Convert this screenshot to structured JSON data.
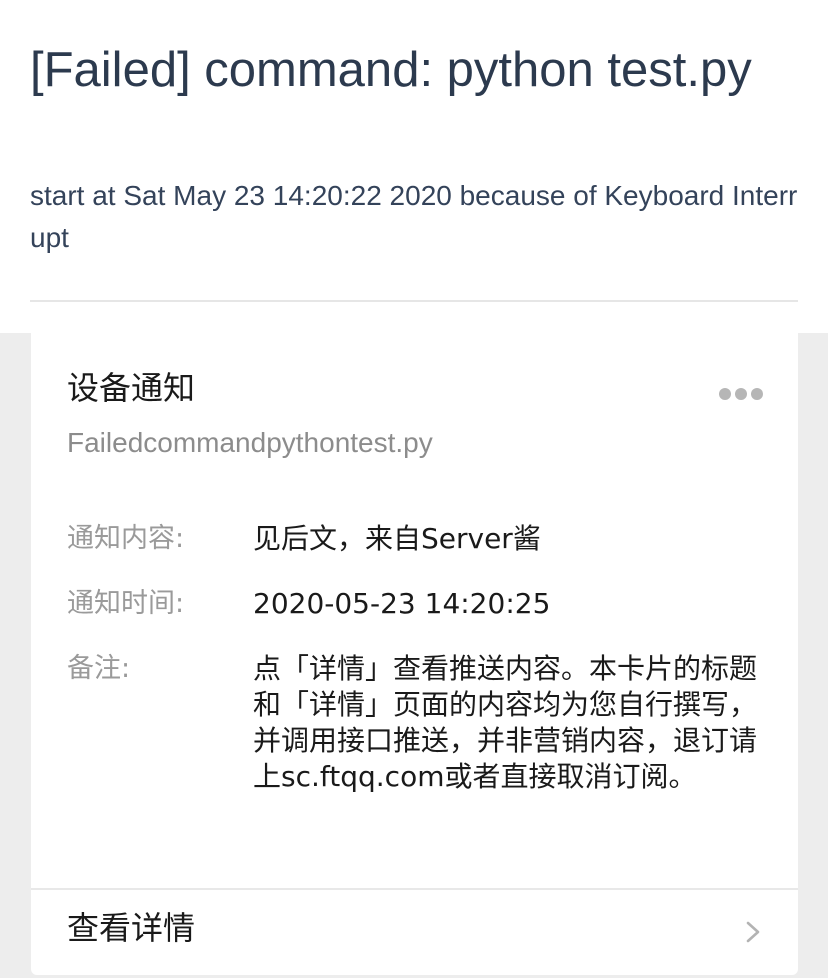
{
  "header": {
    "title": "[Failed] command: python test.py",
    "subtitle": "start at Sat May 23 14:20:22 2020 because of Keyboard Interrupt"
  },
  "card": {
    "title": "设备通知",
    "subtitle": "Failedcommandpythontest.py",
    "more_icon": "more-dots-icon",
    "rows": [
      {
        "label": "通知内容:",
        "value": "见后文，来自Server酱"
      },
      {
        "label": "通知时间:",
        "value": "2020-05-23 14:20:25"
      },
      {
        "label": "备注:",
        "value": "点「详情」查看推送内容。本卡片的标题和「详情」页面的内容均为您自行撰写，并调用接口推送，并非营销内容，退订请上sc.ftqq.com或者直接取消订阅。"
      }
    ],
    "detail_label": "查看详情",
    "detail_icon": "chevron-right-icon"
  },
  "colors": {
    "title_text": "#2c3a4e",
    "page_background": "#ededed",
    "card_background": "#ffffff",
    "label_text": "#9a9a9a"
  }
}
